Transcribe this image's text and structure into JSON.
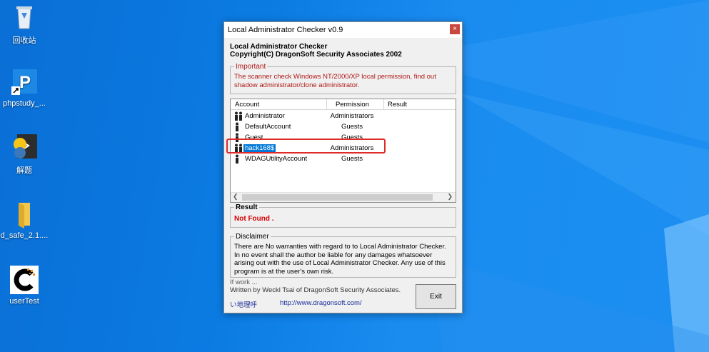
{
  "desktop": {
    "icons": [
      {
        "name": "recycle-bin",
        "label": "回收站"
      },
      {
        "name": "phpstudy",
        "label": "phpstudy_..."
      },
      {
        "name": "jieti",
        "label": "解题"
      },
      {
        "name": "d-safe-folder",
        "label": "d_safe_2.1...."
      },
      {
        "name": "usertest",
        "label": "userTest"
      }
    ]
  },
  "window": {
    "title": "Local Administrator Checker v0.9",
    "close_glyph": "×",
    "header_line1": "Local Administrator Checker",
    "header_line2": "Copyright(C) DragonSoft Security Associates 2002",
    "important": {
      "legend": "Important",
      "text": "The scanner check Windows NT/2000/XP local permission, find out shadow administrator/clone administrator."
    },
    "list": {
      "columns": [
        "Account",
        "Permission",
        "Result"
      ],
      "rows": [
        {
          "account": "Administrator",
          "permission": "Administrators",
          "icon": "double"
        },
        {
          "account": "DefaultAccount",
          "permission": "Guests",
          "icon": "single"
        },
        {
          "account": "Guest",
          "permission": "Guests",
          "icon": "single"
        },
        {
          "account": "hack168$",
          "permission": "Administrators",
          "icon": "double",
          "selected": true
        },
        {
          "account": "WDAGUtilityAccount",
          "permission": "Guests",
          "icon": "single"
        }
      ]
    },
    "result": {
      "legend": "Result",
      "value": "Not Found ."
    },
    "disclaimer": {
      "legend": "Disclaimer",
      "text": "There are No warranties with regard to to Local Administrator Checker. In no event shall the author be liable for any damages whatsoever arising out with the use of Local Administrator Checker. Any use of this program is at the user's own risk."
    },
    "footer": {
      "line1": "If work ...",
      "line2": "Written by Weckl Tsai of DragonSoft Security Associates.",
      "chinese": "い地理呼",
      "url": "http://www.dragonsoft.com/"
    },
    "exit_label": "Exit"
  },
  "colors": {
    "accent": "#0078d7",
    "warning": "#b01818",
    "error": "#d40000",
    "highlight_box": "#e02a2a",
    "desktop": "#0b7be2"
  }
}
